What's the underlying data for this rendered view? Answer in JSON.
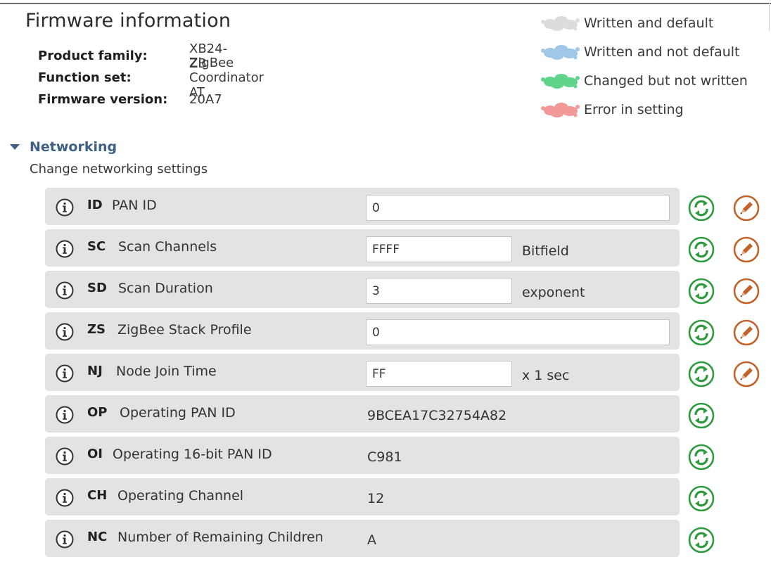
{
  "firmware": {
    "title": "Firmware information",
    "product_family_label": "Product family:",
    "product_family_value": "XB24-ZB",
    "function_set_label": "Function set:",
    "function_set_value": "ZigBee Coordinator AT",
    "firmware_version_label": "Firmware version:",
    "firmware_version_value": "20A7"
  },
  "legend": [
    {
      "label": "Written and default",
      "color": "#dcdcdc",
      "icon": "splash-gray-icon"
    },
    {
      "label": "Written and not default",
      "color": "#9fc8e8",
      "icon": "splash-blue-icon"
    },
    {
      "label": "Changed but not written",
      "color": "#5fd48a",
      "icon": "splash-green-icon"
    },
    {
      "label": "Error in setting",
      "color": "#f29a9a",
      "icon": "splash-red-icon"
    }
  ],
  "section": {
    "title": "Networking",
    "description": "Change networking settings",
    "toggle_icon": "triangle-down-icon"
  },
  "settings": [
    {
      "cmd": "ID",
      "name": "PAN ID",
      "value": "0"
    },
    {
      "cmd": "SC",
      "name": "Scan Channels",
      "value": "FFFF",
      "unit": "Bitfield"
    },
    {
      "cmd": "SD",
      "name": "Scan Duration",
      "value": "3",
      "unit": "exponent"
    },
    {
      "cmd": "ZS",
      "name": "ZigBee Stack Profile",
      "value": "0"
    },
    {
      "cmd": "NJ",
      "name": "Node Join Time",
      "value": "FF",
      "unit": "x 1 sec"
    },
    {
      "cmd": "OP",
      "name": "Operating PAN ID",
      "value": "9BCEA17C32754A82"
    },
    {
      "cmd": "OI",
      "name": "Operating 16-bit PAN ID",
      "value": "C981"
    },
    {
      "cmd": "CH",
      "name": "Operating Channel",
      "value": "12"
    },
    {
      "cmd": "NC",
      "name": "Number of Remaining Children",
      "value": "A"
    }
  ],
  "icons": {
    "info": "info-circle-icon",
    "read": "refresh-read-icon",
    "write": "pencil-write-icon"
  },
  "colors": {
    "section_title": "#3f5f86",
    "row_background": "#e3e3e3",
    "read_button": "#2e9a3e",
    "write_button": "#c0622a"
  }
}
